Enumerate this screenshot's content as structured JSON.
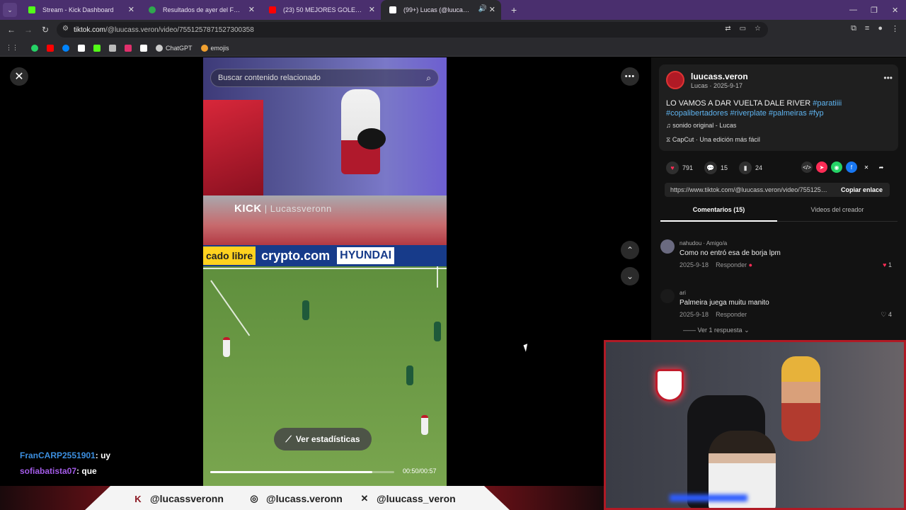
{
  "browser": {
    "tabs": [
      {
        "label": "Stream - Kick Dashboard",
        "favicon_color": "#53fc18"
      },
      {
        "label": "Resultados de ayer del Futbol Argentino",
        "favicon_color": "#2fa84f"
      },
      {
        "label": "(23) 50 MEJORES GOLES DE RIVER",
        "favicon_color": "#ff0000"
      },
      {
        "label": "(99+) Lucas (@luucass.veron)",
        "favicon_color": "#ffffff"
      }
    ],
    "url_host": "tiktok.com",
    "url_path": "/@luucass.veron/video/7551257871527300358",
    "bookmarks": [
      {
        "icon": "whatsapp-icon",
        "label": "",
        "color": "#25d366"
      },
      {
        "icon": "youtube-icon",
        "label": "",
        "color": "#ff0000"
      },
      {
        "icon": "messenger-icon",
        "label": "",
        "color": "#0084ff"
      },
      {
        "icon": "tiktok-icon",
        "label": "",
        "color": "#ffffff"
      },
      {
        "icon": "kick-icon",
        "label": "",
        "color": "#53fc18"
      },
      {
        "icon": "mail-icon",
        "label": "",
        "color": "#bbbbbb"
      },
      {
        "icon": "instagram-icon",
        "label": "",
        "color": "#e1306c"
      },
      {
        "icon": "x-icon",
        "label": "",
        "color": "#ffffff"
      },
      {
        "icon": "chatgpt-icon",
        "label": "ChatGPT",
        "color": "#cccccc"
      },
      {
        "icon": "emoji-icon",
        "label": "emojis",
        "color": "#f0a030"
      }
    ]
  },
  "video": {
    "search_placeholder": "Buscar contenido relacionado",
    "watermark_brand": "KICK",
    "watermark_user": "Lucassveronn",
    "ad_1": "cado libre",
    "ad_2": "crypto.com",
    "ad_3": "HYUNDAI",
    "stats_button": "Ver estadísticas",
    "time": "00:50/00:57",
    "progress": 0.88
  },
  "post": {
    "username": "luucass.veron",
    "meta": "Lucas · 2025-9-17",
    "caption_text": "LO VAMOS A DAR VUELTA DALE RIVER ",
    "caption_tags_1": "#paratiiii",
    "caption_tags_2": "#copalibertadores #riverplate #palmeiras #fyp",
    "sound": "sonido original - Lucas",
    "capcut": "CapCut · Una edición más fácil",
    "likes": "791",
    "comments": "15",
    "saves": "24",
    "link": "https://www.tiktok.com/@luucass.veron/video/7551257871527300358",
    "copy_label": "Copiar enlace",
    "tab_comments": "Comentarios (15)",
    "tab_videos": "Videos del creador"
  },
  "comments": [
    {
      "user": "nahudou · Amigo/a",
      "text": "Como no entró esa de borja lpm",
      "date": "2025-9-18",
      "reply": "Responder",
      "likes": "1"
    },
    {
      "user": "ari",
      "text": "Palmeira juega muitu manito",
      "date": "2025-9-18",
      "reply": "Responder",
      "likes": "4"
    }
  ],
  "view_replies": "Ver 1 respuesta",
  "chat": [
    {
      "user": "FranCARP2551901",
      "msg": ": uy"
    },
    {
      "user": "sofiabatista07",
      "msg": ": que"
    }
  ],
  "footer": {
    "kick": "@lucassveronn",
    "instagram": "@lucass.veronn",
    "x": "@luucass_veron"
  }
}
